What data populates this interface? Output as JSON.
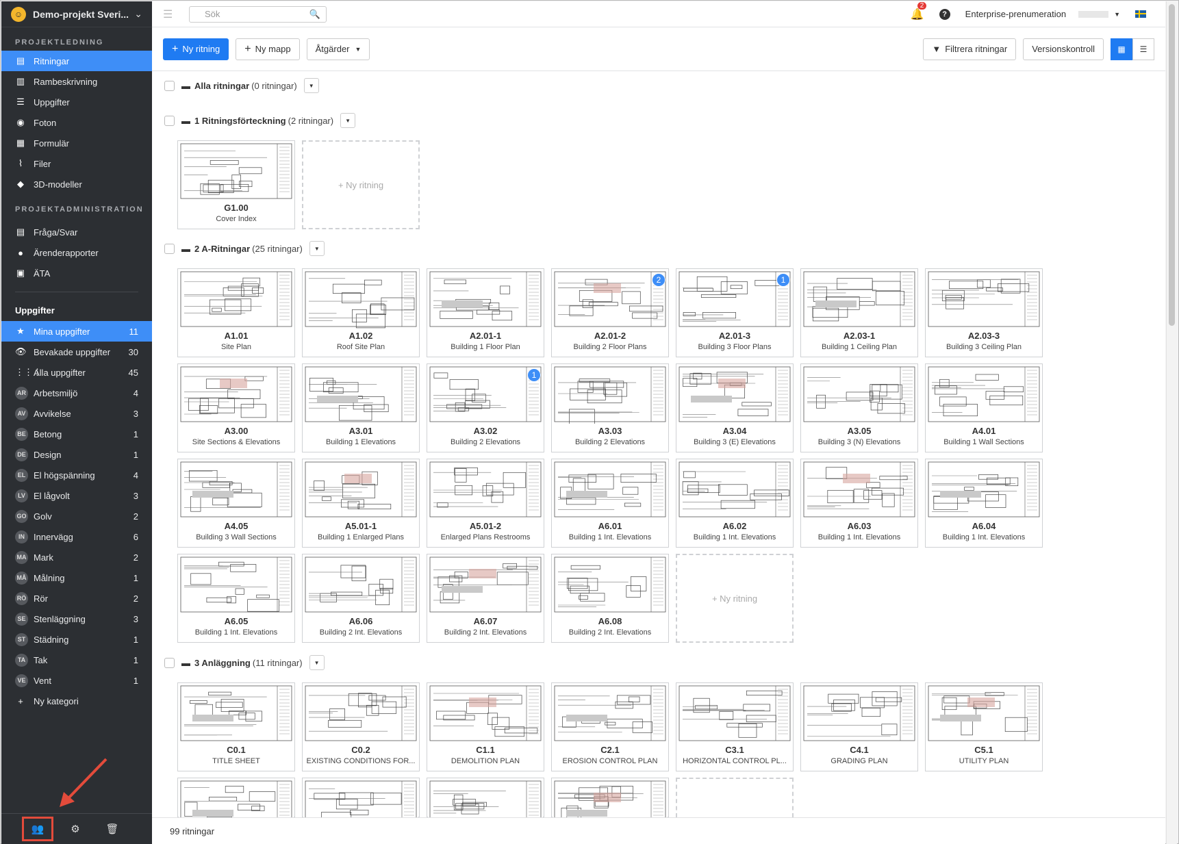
{
  "project": {
    "title": "Demo-projekt Sveri..."
  },
  "sidebar": {
    "section1": "PROJEKTLEDNING",
    "items1": [
      {
        "label": "Ritningar",
        "icon": "drawings-icon"
      },
      {
        "label": "Rambeskrivning",
        "icon": "document-icon"
      },
      {
        "label": "Uppgifter",
        "icon": "list-icon"
      },
      {
        "label": "Foton",
        "icon": "camera-icon"
      },
      {
        "label": "Formulär",
        "icon": "form-icon"
      },
      {
        "label": "Filer",
        "icon": "paperclip-icon"
      },
      {
        "label": "3D-modeller",
        "icon": "cube-icon"
      }
    ],
    "section2": "PROJEKTADMINISTRATION",
    "items2": [
      {
        "label": "Fråga/Svar",
        "icon": "qa-icon"
      },
      {
        "label": "Ärenderapporter",
        "icon": "person-icon"
      },
      {
        "label": "ÄTA",
        "icon": "camera-box-icon"
      }
    ],
    "tasks_title": "Uppgifter",
    "tasks": [
      {
        "label": "Mina uppgifter",
        "count": "11",
        "icon": "★"
      },
      {
        "label": "Bevakade uppgifter",
        "count": "30",
        "icon": "👁"
      },
      {
        "label": "Alla uppgifter",
        "count": "45",
        "icon": "⋮⋮⋮"
      }
    ],
    "categories": [
      {
        "abbr": "AR",
        "label": "Arbetsmiljö",
        "count": "4"
      },
      {
        "abbr": "AV",
        "label": "Avvikelse",
        "count": "3"
      },
      {
        "abbr": "BE",
        "label": "Betong",
        "count": "1"
      },
      {
        "abbr": "DE",
        "label": "Design",
        "count": "1"
      },
      {
        "abbr": "EL",
        "label": "El högspänning",
        "count": "4"
      },
      {
        "abbr": "LV",
        "label": "El lågvolt",
        "count": "3"
      },
      {
        "abbr": "GO",
        "label": "Golv",
        "count": "2"
      },
      {
        "abbr": "IN",
        "label": "Innervägg",
        "count": "6"
      },
      {
        "abbr": "MA",
        "label": "Mark",
        "count": "2"
      },
      {
        "abbr": "MÅ",
        "label": "Målning",
        "count": "1"
      },
      {
        "abbr": "RÖ",
        "label": "Rör",
        "count": "2"
      },
      {
        "abbr": "SE",
        "label": "Stenläggning",
        "count": "3"
      },
      {
        "abbr": "ST",
        "label": "Städning",
        "count": "1"
      },
      {
        "abbr": "TA",
        "label": "Tak",
        "count": "1"
      },
      {
        "abbr": "VE",
        "label": "Vent",
        "count": "1"
      }
    ],
    "new_category": "Ny kategori"
  },
  "topbar": {
    "search_placeholder": "Sök",
    "notifications": "2",
    "help": "?",
    "subscription": "Enterprise-prenumeration"
  },
  "toolbar": {
    "new_drawing": "Ny ritning",
    "new_folder": "Ny mapp",
    "actions": "Åtgärder",
    "filter": "Filtrera ritningar",
    "version": "Versionskontroll"
  },
  "folders": [
    {
      "name": "Alla ritningar",
      "count": "(0 ritningar)"
    },
    {
      "name": "1 Ritningsförteckning",
      "count": "(2 ritningar)"
    },
    {
      "name": "2 A-Ritningar",
      "count": "(25 ritningar)"
    },
    {
      "name": "3 Anläggning",
      "count": "(11 ritningar)"
    }
  ],
  "new_drawing_card": "+ Ny ritning",
  "drawings_f1": [
    {
      "code": "G1.00",
      "name": "Cover Index"
    }
  ],
  "drawings_f2": [
    {
      "code": "A1.01",
      "name": "Site Plan",
      "badge": ""
    },
    {
      "code": "A1.02",
      "name": "Roof Site Plan",
      "badge": ""
    },
    {
      "code": "A2.01-1",
      "name": "Building 1 Floor Plan",
      "badge": ""
    },
    {
      "code": "A2.01-2",
      "name": "Building 2 Floor Plans",
      "badge": "2"
    },
    {
      "code": "A2.01-3",
      "name": "Building 3 Floor Plans",
      "badge": "1"
    },
    {
      "code": "A2.03-1",
      "name": "Building 1 Ceiling Plan",
      "badge": ""
    },
    {
      "code": "A2.03-3",
      "name": "Building 3 Ceiling Plan",
      "badge": ""
    },
    {
      "code": "A3.00",
      "name": "Site Sections & Elevations",
      "badge": ""
    },
    {
      "code": "A3.01",
      "name": "Building 1 Elevations",
      "badge": ""
    },
    {
      "code": "A3.02",
      "name": "Building 2 Elevations",
      "badge": "1"
    },
    {
      "code": "A3.03",
      "name": "Building 2 Elevations",
      "badge": ""
    },
    {
      "code": "A3.04",
      "name": "Building 3 (E) Elevations",
      "badge": ""
    },
    {
      "code": "A3.05",
      "name": "Building 3 (N) Elevations",
      "badge": ""
    },
    {
      "code": "A4.01",
      "name": "Building 1 Wall Sections",
      "badge": ""
    },
    {
      "code": "A4.05",
      "name": "Building 3 Wall Sections",
      "badge": ""
    },
    {
      "code": "A5.01-1",
      "name": "Building 1 Enlarged Plans",
      "badge": ""
    },
    {
      "code": "A5.01-2",
      "name": "Enlarged Plans Restrooms",
      "badge": ""
    },
    {
      "code": "A6.01",
      "name": "Building 1 Int. Elevations",
      "badge": ""
    },
    {
      "code": "A6.02",
      "name": "Building 1 Int. Elevations",
      "badge": ""
    },
    {
      "code": "A6.03",
      "name": "Building 1 Int. Elevations",
      "badge": ""
    },
    {
      "code": "A6.04",
      "name": "Building 1 Int. Elevations",
      "badge": ""
    },
    {
      "code": "A6.05",
      "name": "Building 1 Int. Elevations",
      "badge": ""
    },
    {
      "code": "A6.06",
      "name": "Building 2 Int. Elevations",
      "badge": ""
    },
    {
      "code": "A6.07",
      "name": "Building 2 Int. Elevations",
      "badge": ""
    },
    {
      "code": "A6.08",
      "name": "Building 2 Int. Elevations",
      "badge": ""
    }
  ],
  "drawings_f3": [
    {
      "code": "C0.1",
      "name": "TITLE SHEET"
    },
    {
      "code": "C0.2",
      "name": "EXISTING CONDITIONS FOR..."
    },
    {
      "code": "C1.1",
      "name": "DEMOLITION PLAN"
    },
    {
      "code": "C2.1",
      "name": "EROSION CONTROL PLAN"
    },
    {
      "code": "C3.1",
      "name": "HORIZONTAL CONTROL PL..."
    },
    {
      "code": "C4.1",
      "name": "GRADING PLAN"
    },
    {
      "code": "C5.1",
      "name": "UTILITY PLAN"
    },
    {
      "code": "",
      "name": ""
    },
    {
      "code": "",
      "name": ""
    },
    {
      "code": "",
      "name": ""
    },
    {
      "code": "",
      "name": ""
    }
  ],
  "footer": {
    "total": "99 ritningar"
  },
  "colors": {
    "sidebar": "#2c2f33",
    "accent": "#3e8ef7",
    "primary": "#1f7bf2",
    "highlight": "#e34b3b"
  }
}
